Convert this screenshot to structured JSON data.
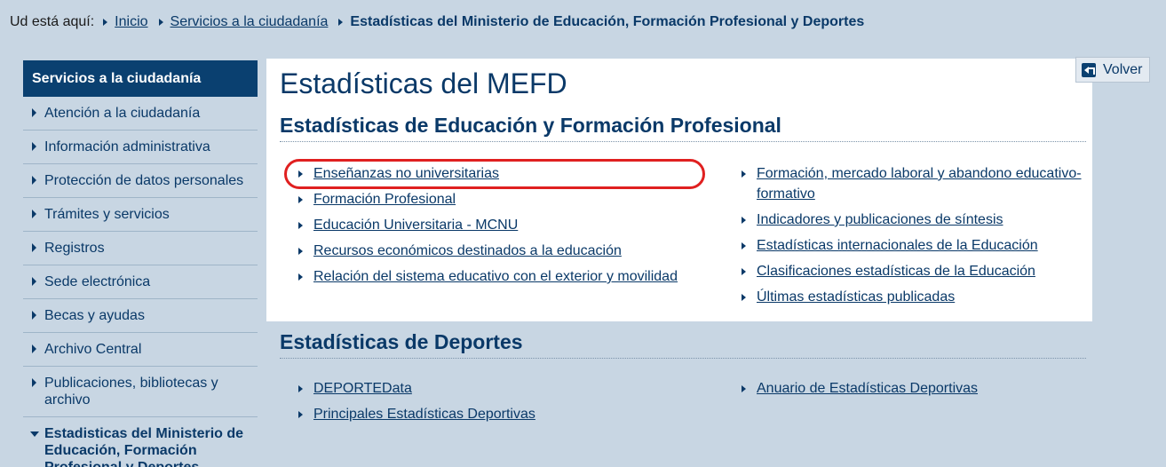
{
  "breadcrumb": {
    "lead": "Ud está aquí:",
    "items": [
      "Inicio",
      "Servicios a la ciudadanía"
    ],
    "current": "Estadísticas del Ministerio de Educación, Formación Profesional y Deportes"
  },
  "sidebar": {
    "header": "Servicios a la ciudadanía",
    "items": [
      {
        "label": "Atención a la ciudadanía"
      },
      {
        "label": "Información administrativa"
      },
      {
        "label": "Protección de datos personales"
      },
      {
        "label": "Trámites y servicios"
      },
      {
        "label": "Registros"
      },
      {
        "label": "Sede electrónica"
      },
      {
        "label": "Becas y ayudas"
      },
      {
        "label": "Archivo Central"
      },
      {
        "label": "Publicaciones, bibliotecas y archivo"
      },
      {
        "label": "Estadisticas del Ministerio de Educación, Formación Profesional y Deportes"
      }
    ]
  },
  "main": {
    "title": "Estadísticas del MEFD",
    "volver": "Volver",
    "education": {
      "title": "Estadísticas de Educación y Formación Profesional",
      "left": [
        "Enseñanzas no universitarias",
        "Formación Profesional",
        "Educación Universitaria - MCNU",
        "Recursos económicos destinados a la educación",
        "Relación del sistema educativo con el exterior y movilidad"
      ],
      "right": [
        "Formación, mercado laboral y abandono educativo-formativo",
        "Indicadores y publicaciones de síntesis",
        "Estadísticas internacionales de la Educación",
        "Clasificaciones estadísticas de la Educación",
        "Últimas estadísticas publicadas"
      ]
    },
    "sports": {
      "title": "Estadísticas de Deportes",
      "left": [
        "DEPORTEData",
        "Principales Estadísticas Deportivas"
      ],
      "right": [
        "Anuario de Estadísticas Deportivas"
      ]
    }
  },
  "colors": {
    "background": "#c8d6e3",
    "accent": "#0a4070",
    "link": "#0a3968",
    "highlight": "#e02020"
  }
}
